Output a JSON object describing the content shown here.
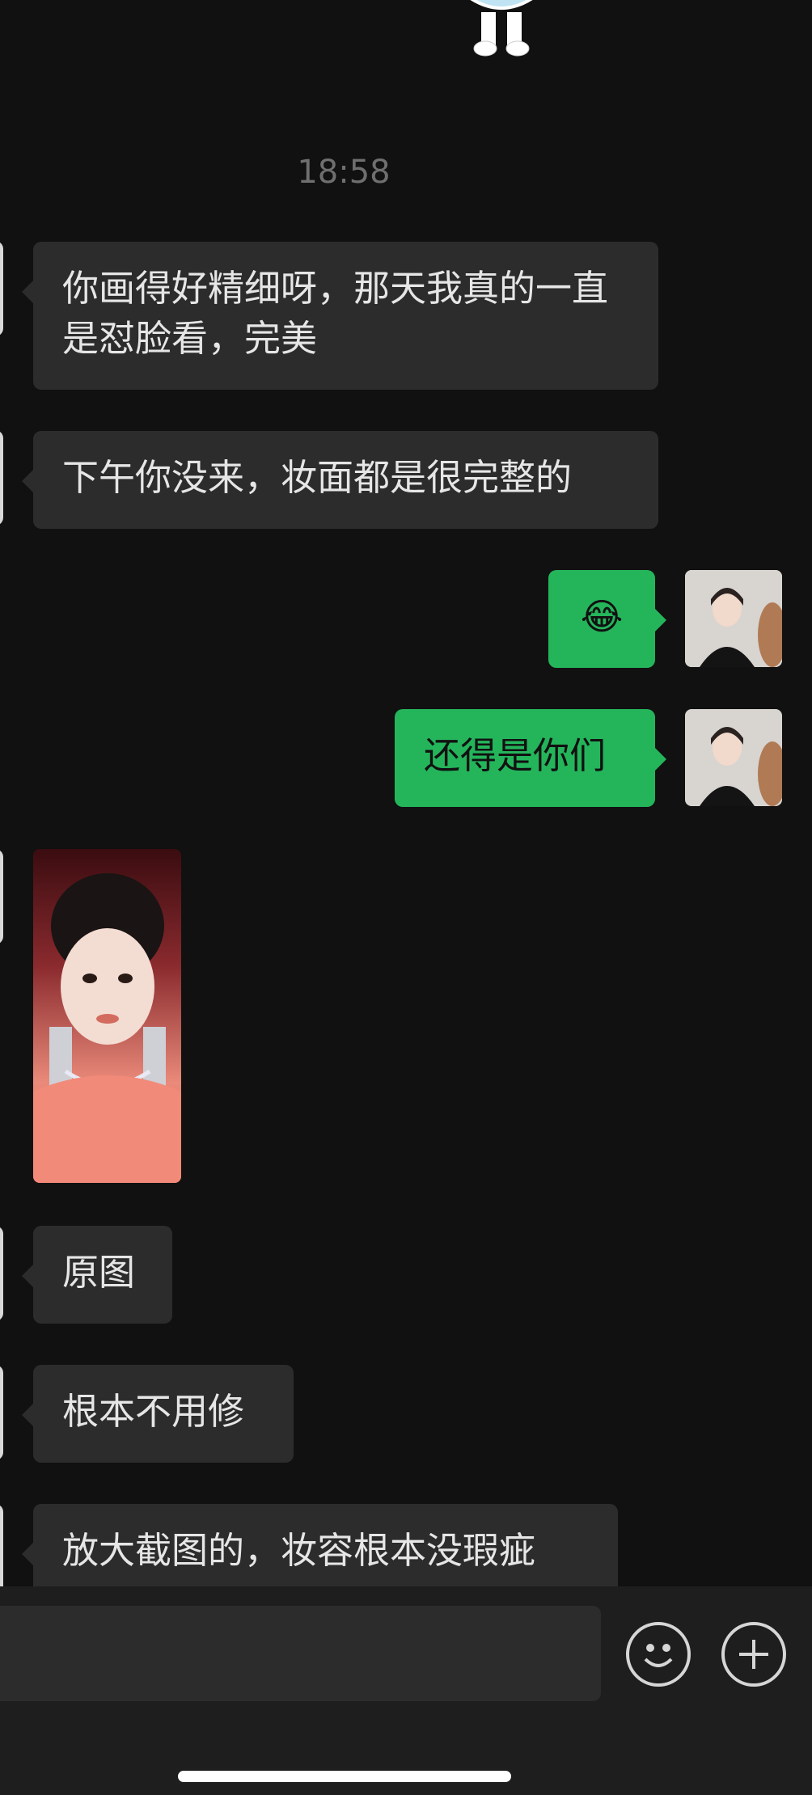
{
  "timestamp": "18:58",
  "messages": [
    {
      "side": "left",
      "text": "你画得好精细呀，那天我真的一直是怼脸看，完美"
    },
    {
      "side": "left",
      "text": "下午你没来，妆面都是很完整的"
    },
    {
      "side": "right",
      "text": "😂"
    },
    {
      "side": "right",
      "text": "还得是你们"
    },
    {
      "side": "left",
      "text": "原图"
    },
    {
      "side": "left",
      "text": "根本不用修"
    },
    {
      "side": "left",
      "text": "放大截图的，妆容根本没瑕疵"
    }
  ],
  "input": {
    "value": "",
    "placeholder": ""
  },
  "icons": {
    "emoji": "smile-face-icon",
    "add": "plus-circle-icon"
  },
  "colors": {
    "background": "#111111",
    "bubble_left": "#2c2c2c",
    "bubble_right": "#24b55b",
    "timestamp": "#6f6f6f"
  }
}
